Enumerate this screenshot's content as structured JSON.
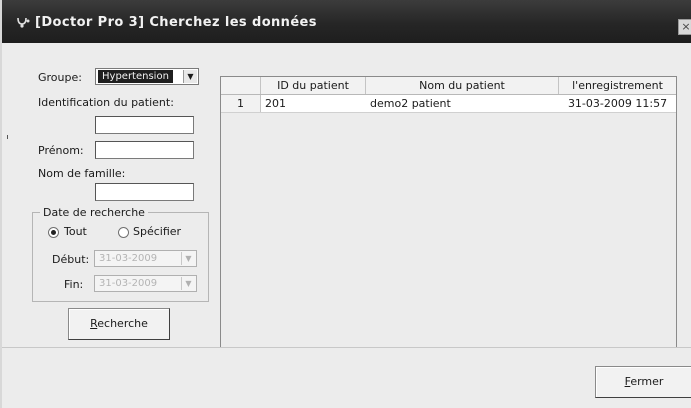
{
  "window": {
    "title": "[Doctor Pro 3] Cherchez les données",
    "close_glyph": "×"
  },
  "form": {
    "group_label": "Groupe:",
    "group_value": "Hypertension",
    "patient_id_label": "Identification du patient:",
    "patient_id_value": "",
    "first_name_label": "Prénom:",
    "first_name_value": "",
    "last_name_label": "Nom de famille:",
    "last_name_value": "",
    "date_group": {
      "title": "Date de recherche",
      "option_all": "Tout",
      "option_specify": "Spécifier",
      "selected": "Tout",
      "start_label": "Début:",
      "start_value": "31-03-2009",
      "end_label": "Fin:",
      "end_value": "31-03-2009"
    },
    "search_button": {
      "accel": "R",
      "rest": "echerche"
    }
  },
  "table": {
    "columns": [
      "",
      "ID du patient",
      "Nom du patient",
      "l'enregistrement"
    ],
    "rows": [
      {
        "index": "1",
        "patient_id": "201",
        "patient_name": "demo2 patient",
        "record_date": "31-03-2009 11:57"
      }
    ]
  },
  "footer": {
    "close_button": {
      "accel": "F",
      "rest": "ermer"
    }
  },
  "icons": {
    "app": "stethoscope-icon",
    "dropdown": "chevron-down-icon",
    "close": "close-icon"
  },
  "colors": {
    "titlebar": "#262626",
    "window_bg": "#ececec",
    "selection": "#1f1f1f"
  }
}
